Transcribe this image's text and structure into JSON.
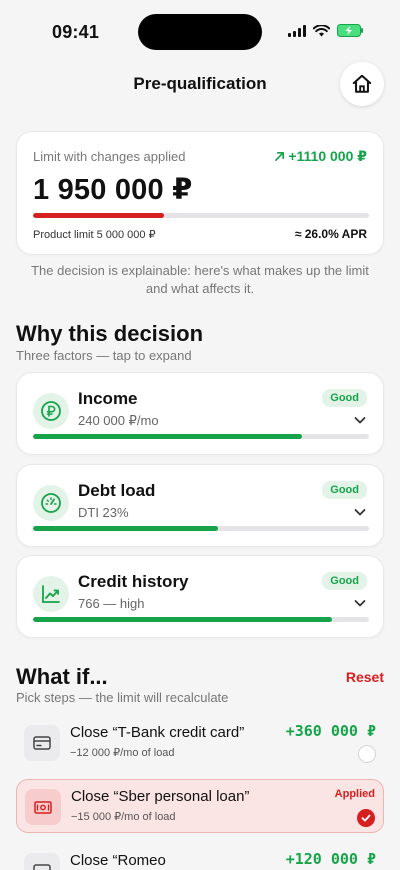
{
  "status_bar": {
    "time": "09:41"
  },
  "header": {
    "title": "Pre-qualification"
  },
  "limit_card": {
    "label": "Limit with changes applied",
    "delta": "+1110 000 ₽",
    "amount": "1 950 000 ₽",
    "progress": 0.39,
    "product_limit": "Product limit 5 000 000 ₽",
    "apr": "≈ 26.0% APR"
  },
  "explain": {
    "line1": "The decision is explainable: here's what makes up the limit",
    "line2": "and what affects it."
  },
  "why": {
    "title": "Why this decision",
    "subtitle": "Three factors — tap to expand",
    "factors": [
      {
        "title": "Income",
        "sub": "240 000 ₽/mo",
        "badge": "Good",
        "progress": 0.8,
        "icon": "ruble-icon"
      },
      {
        "title": "Debt load",
        "sub": "DTI 23%",
        "badge": "Good",
        "progress": 0.55,
        "icon": "gauge-icon"
      },
      {
        "title": "Credit history",
        "sub": "766 — high",
        "badge": "Good",
        "progress": 0.89,
        "icon": "trend-up-icon"
      }
    ]
  },
  "what_if": {
    "title": "What if...",
    "subtitle": "Pick steps — the limit will recalculate",
    "reset_label": "Reset",
    "steps": [
      {
        "title": "Close “T-Bank credit card”",
        "sub": "−12 000 ₽/mo of load",
        "amount": "+360 000 ₽",
        "applied": false
      },
      {
        "title": "Close “Sber personal loan”",
        "sub": "−15 000 ₽/mo of load",
        "applied_label": "Applied",
        "applied": true
      },
      {
        "title": "Close “Romeo",
        "amount": "+120 000 ₽",
        "applied": false
      }
    ]
  },
  "colors": {
    "accent_red": "#d61f1f",
    "accent_green": "#16a34a",
    "background": "#f5f5f6"
  }
}
